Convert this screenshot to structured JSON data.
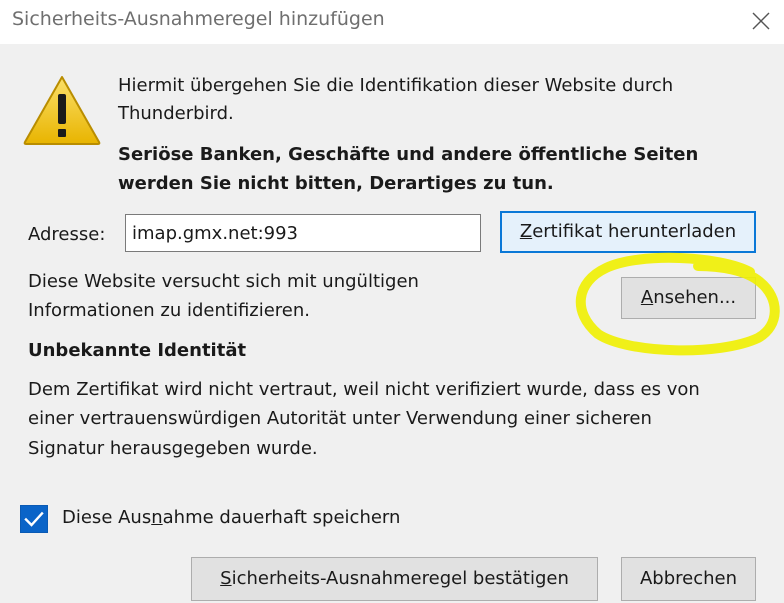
{
  "window": {
    "title": "Sicherheits-Ausnahmeregel hinzufügen",
    "close_icon": "close-icon"
  },
  "warning": {
    "icon": "warning-triangle-icon",
    "intro_line1": "Hiermit übergehen Sie die Identifikation dieser Website durch",
    "intro_line2": "Thunderbird.",
    "bold_line1": "Seriöse Banken, Geschäfte und andere öffentliche Seiten",
    "bold_line2": "werden Sie nicht bitten, Derartiges zu tun."
  },
  "address": {
    "label": "Adresse:",
    "value": "imap.gmx.net:993"
  },
  "buttons": {
    "download_label_mn": "Z",
    "download_label_rest": "ertifikat herunterladen",
    "view_label_mn": "A",
    "view_label_rest": "nsehen...",
    "confirm_label_mn": "S",
    "confirm_label_rest": "icherheits-Ausnahmeregel bestätigen",
    "cancel_label": "Abbrechen"
  },
  "status": {
    "site_line1": "Diese Website versucht sich mit ungültigen",
    "site_line2": "Informationen zu identifizieren.",
    "heading": "Unbekannte Identität",
    "desc_line1": "Dem Zertifikat wird nicht vertraut, weil nicht verifiziert wurde, dass es von",
    "desc_line2": "einer vertrauenswürdigen Autorität unter Verwendung einer sicheren",
    "desc_line3": "Signatur herausgegeben wurde."
  },
  "permanent": {
    "checked": true,
    "label_pre": "Diese Aus",
    "label_mn": "n",
    "label_post": "ahme dauerhaft speichern"
  },
  "colors": {
    "accent": "#0a64c8",
    "highlight": "#f0f000"
  }
}
